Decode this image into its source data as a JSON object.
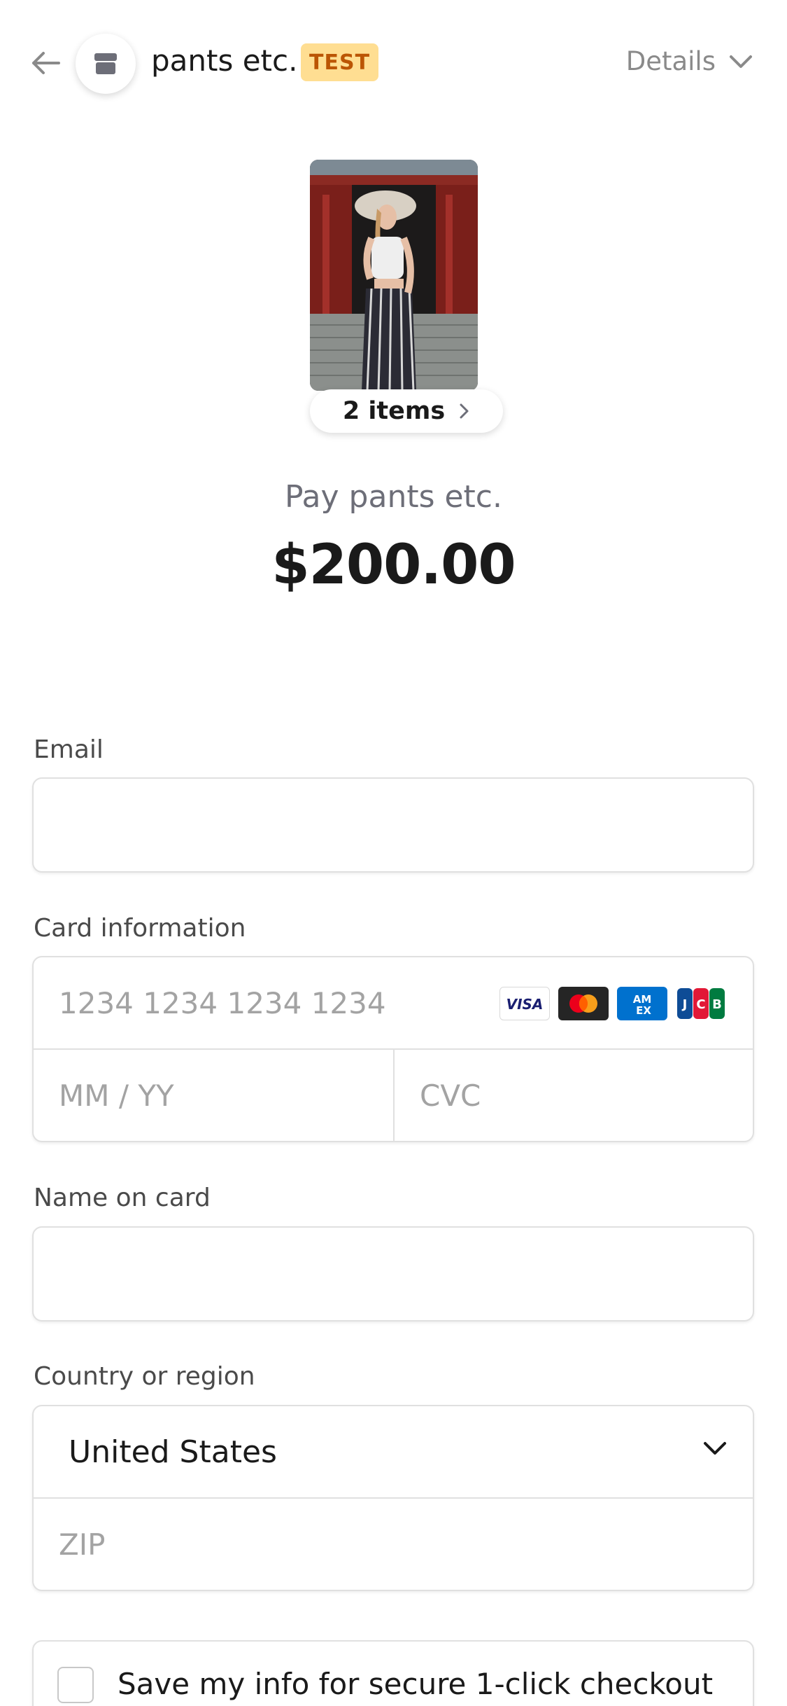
{
  "header": {
    "store_name": "pants etc.",
    "badge": "TEST",
    "details_label": "Details"
  },
  "product": {
    "items_label": "2 items",
    "pay_label": "Pay pants etc.",
    "amount": "$200.00"
  },
  "form": {
    "email": {
      "label": "Email",
      "value": "",
      "placeholder": ""
    },
    "card": {
      "label": "Card information",
      "number_placeholder": "1234 1234 1234 1234",
      "expiry_placeholder": "MM / YY",
      "cvc_placeholder": "CVC",
      "brands": [
        "visa",
        "mastercard",
        "amex",
        "jcb"
      ]
    },
    "name": {
      "label": "Name on card",
      "value": "",
      "placeholder": ""
    },
    "country": {
      "label": "Country or region",
      "selected": "United States",
      "zip_placeholder": "ZIP"
    },
    "save_info": {
      "label": "Save my info for secure 1-click checkout",
      "checked": false
    }
  },
  "colors": {
    "badge_bg": "#ffde92",
    "badge_text": "#bb5504",
    "muted_text": "#6d6e78",
    "border": "#e0e0e0"
  }
}
